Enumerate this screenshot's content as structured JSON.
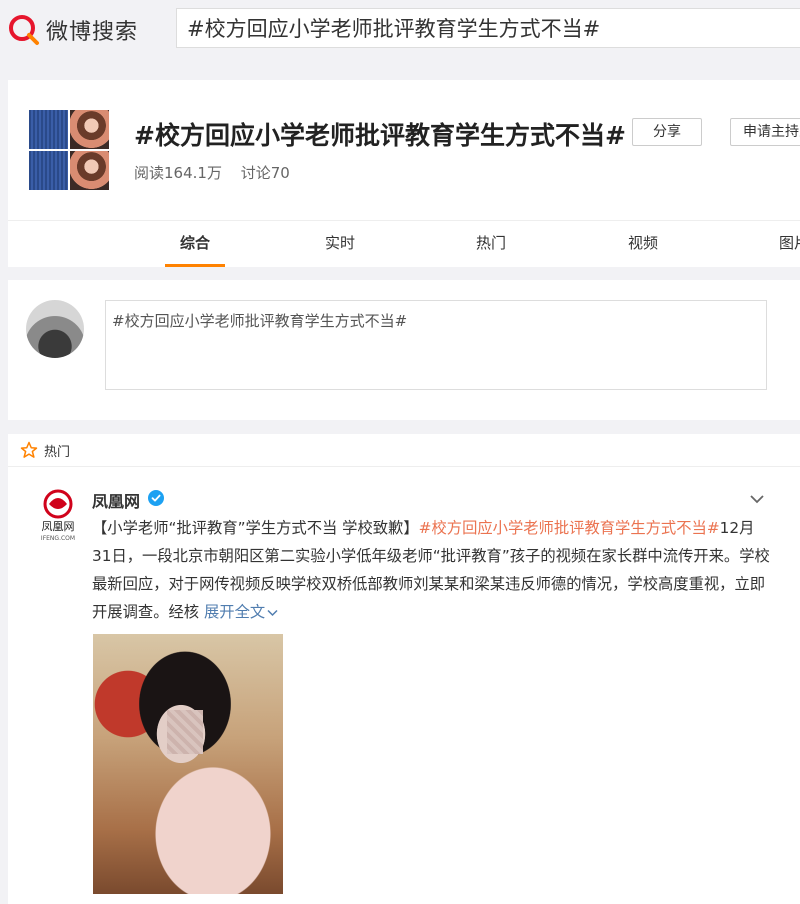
{
  "app": {
    "logo_text": "微博搜索",
    "search_query": "#校方回应小学老师批评教育学生方式不当#"
  },
  "topic": {
    "title": "#校方回应小学老师批评教育学生方式不当#",
    "reads": "阅读164.1万",
    "discussions": "讨论70",
    "share_label": "分享",
    "host_label": "申请主持人"
  },
  "tabs": [
    {
      "label": "综合",
      "active": true
    },
    {
      "label": "实时",
      "active": false
    },
    {
      "label": "热门",
      "active": false
    },
    {
      "label": "视频",
      "active": false
    },
    {
      "label": "图片",
      "active": false
    }
  ],
  "composer": {
    "value": "#校方回应小学老师批评教育学生方式不当#"
  },
  "feed": {
    "section_label": "热门",
    "post": {
      "user": "凤凰网",
      "avatar_text": "凤凰网",
      "avatar_subtext": "IFENG.COM",
      "text_prefix": "【小学老师“批评教育”学生方式不当 学校致歉】",
      "tag": "#校方回应小学老师批评教育学生方式不当#",
      "text_body": "12月31日，一段北京市朝阳区第二实验小学低年级老师“批评教育”孩子的视频在家长群中流传开来。学校最新回应，对于网传视频反映学校双桥低部教师刘某某和梁某违反师德的情况，学校高度重视，立即开展调查。经核",
      "expand_label": "展开全文"
    }
  },
  "colors": {
    "accent": "#ff8200",
    "link": "#507daf",
    "tag": "#eb7350",
    "verified": "#1da1f2"
  }
}
